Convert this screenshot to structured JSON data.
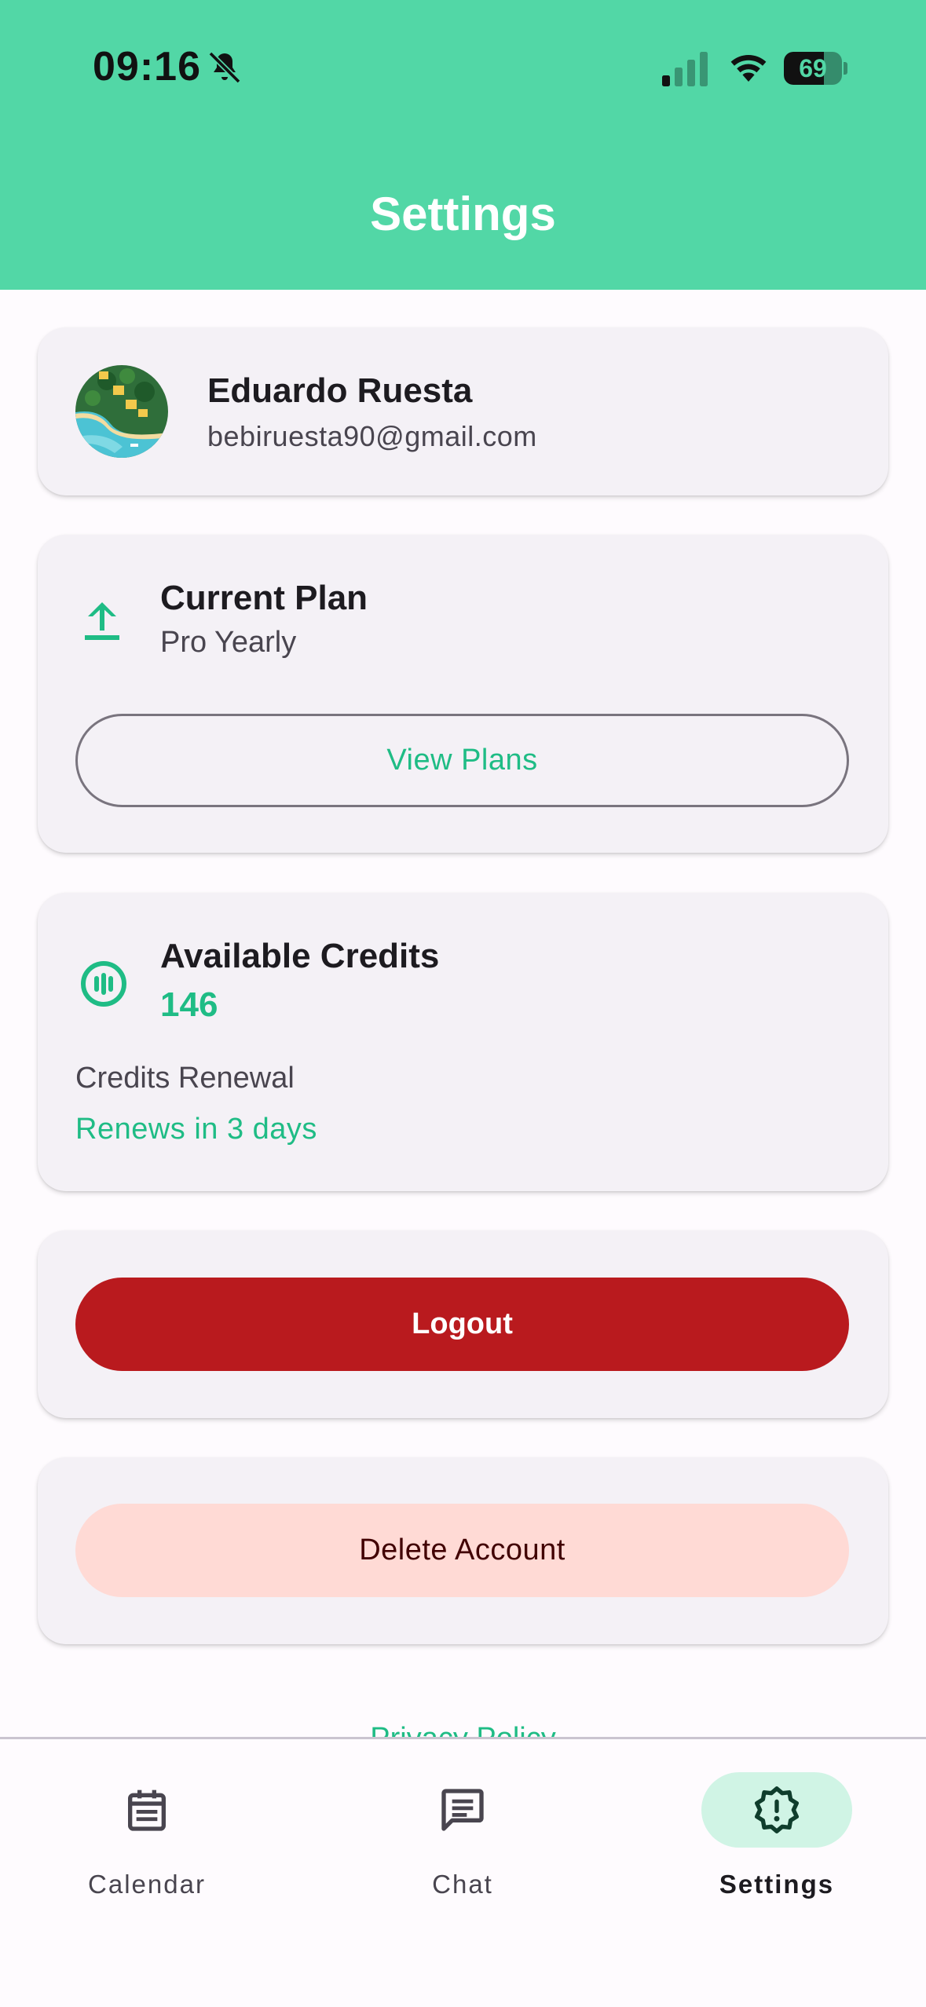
{
  "status_bar": {
    "time": "09:16",
    "battery_percent": "69",
    "battery_level": 0.69,
    "icons": [
      "bell-slash-icon",
      "signal-icon",
      "wifi-icon",
      "battery-icon"
    ]
  },
  "header": {
    "title": "Settings",
    "background_color": "#52d7a6"
  },
  "profile": {
    "name": "Eduardo Ruesta",
    "email": "bebiruesta90@gmail.com"
  },
  "plan": {
    "title": "Current Plan",
    "value": "Pro Yearly",
    "button_label": "View Plans",
    "icon": "upload-arrow-icon"
  },
  "credits": {
    "title": "Available Credits",
    "value": "146",
    "renewal_label": "Credits Renewal",
    "renewal_value": "Renews in 3 days",
    "icon": "credits-coin-icon"
  },
  "actions": {
    "logout_label": "Logout",
    "delete_label": "Delete Account"
  },
  "footer": {
    "privacy_label": "Privacy Policy"
  },
  "nav": {
    "items": [
      {
        "label": "Calendar",
        "icon": "calendar-icon",
        "active": false
      },
      {
        "label": "Chat",
        "icon": "chat-icon",
        "active": false
      },
      {
        "label": "Settings",
        "icon": "settings-icon",
        "active": true
      }
    ]
  },
  "colors": {
    "accent": "#1fbc85",
    "danger": "#b91a1e",
    "danger_container": "#ffdad5",
    "card_background": "#f4f1f6",
    "active_nav_pill": "#d0f4e5"
  }
}
